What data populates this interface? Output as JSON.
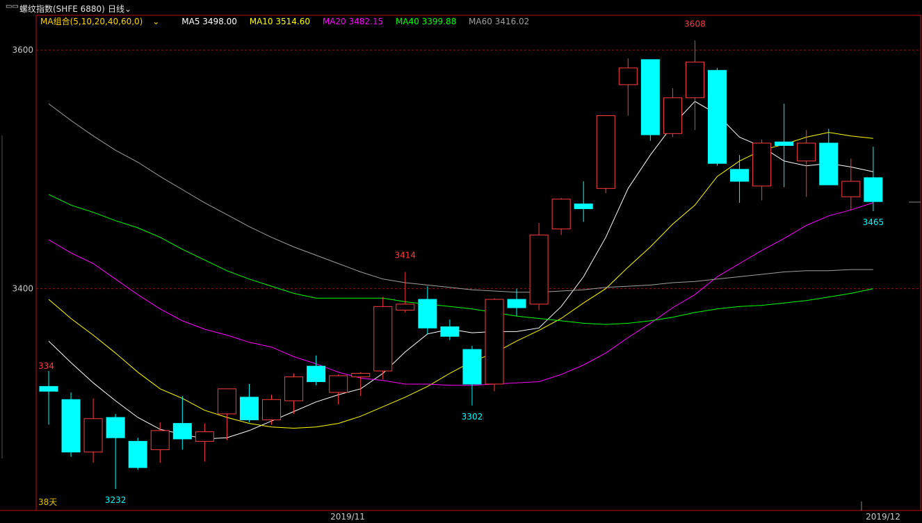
{
  "header": {
    "instrument": "螺纹指数(SHFE 6880)",
    "period": "日线",
    "period_icon": "chevron-down-icon",
    "window_icon": "window-icon"
  },
  "legend": {
    "group_label": "MA组合(5,10,20,40,60,0)",
    "ma5": "MA5 3498.00",
    "ma10": "MA10 3514.60",
    "ma20": "MA20 3482.15",
    "ma40": "MA40 3399.88",
    "ma60": "MA60 3416.02"
  },
  "colors": {
    "up": "#ff3c3c",
    "down": "#00ffff",
    "ma5": "#ffffff",
    "ma10": "#ffff00",
    "ma20": "#ff00ff",
    "ma40": "#00ff00",
    "ma60": "#a0a0a0",
    "border": "#c01010"
  },
  "chart_data": {
    "type": "candlestick",
    "ytick_labels": [
      "3600",
      "3400"
    ],
    "yticks": [
      3600,
      3400
    ],
    "ylim": [
      3214,
      3628
    ],
    "xtick_labels": [
      "2019/11",
      "2019/12"
    ],
    "corner_label_top": "334",
    "corner_label_bottom": "38天",
    "annotations": [
      {
        "label": "3608",
        "index": 29,
        "value": 3608,
        "kind": "high"
      },
      {
        "label": "3414",
        "index": 16,
        "value": 3414,
        "kind": "high"
      },
      {
        "label": "3302",
        "index": 19,
        "value": 3302,
        "kind": "low"
      },
      {
        "label": "3232",
        "index": 3,
        "value": 3232,
        "kind": "low"
      },
      {
        "label": "3465",
        "index": 37,
        "value": 3465,
        "kind": "low"
      }
    ],
    "candles": [
      {
        "o": 3318,
        "h": 3331,
        "l": 3286,
        "c": 3314
      },
      {
        "o": 3307,
        "h": 3313,
        "l": 3259,
        "c": 3263
      },
      {
        "o": 3263,
        "h": 3308,
        "l": 3254,
        "c": 3291
      },
      {
        "o": 3292,
        "h": 3295,
        "l": 3232,
        "c": 3275
      },
      {
        "o": 3272,
        "h": 3275,
        "l": 3248,
        "c": 3250
      },
      {
        "o": 3265,
        "h": 3288,
        "l": 3254,
        "c": 3281
      },
      {
        "o": 3287,
        "h": 3310,
        "l": 3265,
        "c": 3274
      },
      {
        "o": 3272,
        "h": 3287,
        "l": 3255,
        "c": 3280
      },
      {
        "o": 3295,
        "h": 3303,
        "l": 3273,
        "c": 3316
      },
      {
        "o": 3309,
        "h": 3320,
        "l": 3288,
        "c": 3290
      },
      {
        "o": 3290,
        "h": 3311,
        "l": 3286,
        "c": 3307
      },
      {
        "o": 3306,
        "h": 3329,
        "l": 3295,
        "c": 3326
      },
      {
        "o": 3335,
        "h": 3344,
        "l": 3319,
        "c": 3322
      },
      {
        "o": 3313,
        "h": 3328,
        "l": 3303,
        "c": 3327
      },
      {
        "o": 3326,
        "h": 3330,
        "l": 3310,
        "c": 3329
      },
      {
        "o": 3331,
        "h": 3393,
        "l": 3324,
        "c": 3385
      },
      {
        "o": 3382,
        "h": 3414,
        "l": 3380,
        "c": 3387
      },
      {
        "o": 3391,
        "h": 3402,
        "l": 3362,
        "c": 3367
      },
      {
        "o": 3368,
        "h": 3374,
        "l": 3357,
        "c": 3360
      },
      {
        "o": 3349,
        "h": 3352,
        "l": 3302,
        "c": 3320
      },
      {
        "o": 3320,
        "h": 3392,
        "l": 3314,
        "c": 3391
      },
      {
        "o": 3391,
        "h": 3400,
        "l": 3377,
        "c": 3384
      },
      {
        "o": 3387,
        "h": 3455,
        "l": 3382,
        "c": 3445
      },
      {
        "o": 3450,
        "h": 3476,
        "l": 3445,
        "c": 3475
      },
      {
        "o": 3471,
        "h": 3490,
        "l": 3456,
        "c": 3467
      },
      {
        "o": 3484,
        "h": 3539,
        "l": 3480,
        "c": 3545
      },
      {
        "o": 3571,
        "h": 3593,
        "l": 3545,
        "c": 3585
      },
      {
        "o": 3592,
        "h": 3591,
        "l": 3524,
        "c": 3529
      },
      {
        "o": 3530,
        "h": 3568,
        "l": 3527,
        "c": 3560
      },
      {
        "o": 3560,
        "h": 3608,
        "l": 3533,
        "c": 3590
      },
      {
        "o": 3583,
        "h": 3585,
        "l": 3503,
        "c": 3505
      },
      {
        "o": 3500,
        "h": 3512,
        "l": 3472,
        "c": 3490
      },
      {
        "o": 3486,
        "h": 3525,
        "l": 3474,
        "c": 3522
      },
      {
        "o": 3523,
        "h": 3555,
        "l": 3485,
        "c": 3520
      },
      {
        "o": 3507,
        "h": 3533,
        "l": 3477,
        "c": 3522
      },
      {
        "o": 3522,
        "h": 3534,
        "l": 3487,
        "c": 3487
      },
      {
        "o": 3477,
        "h": 3509,
        "l": 3466,
        "c": 3490
      },
      {
        "o": 3493,
        "h": 3519,
        "l": 3465,
        "c": 3473
      }
    ],
    "series": [
      {
        "name": "MA5",
        "values": [
          3356,
          3338,
          3321,
          3306,
          3292,
          3282,
          3278,
          3274,
          3275,
          3281,
          3289,
          3297,
          3305,
          3311,
          3316,
          3329,
          3347,
          3362,
          3366,
          3363,
          3364,
          3364,
          3367,
          3385,
          3410,
          3443,
          3484,
          3512,
          3537,
          3557,
          3546,
          3527,
          3519,
          3507,
          3503,
          3505,
          3502,
          3498
        ]
      },
      {
        "name": "MA10",
        "values": [
          3391,
          3375,
          3361,
          3346,
          3330,
          3316,
          3308,
          3298,
          3292,
          3287,
          3284,
          3283,
          3284,
          3287,
          3293,
          3301,
          3309,
          3318,
          3329,
          3339,
          3346,
          3356,
          3365,
          3375,
          3388,
          3400,
          3418,
          3435,
          3454,
          3470,
          3494,
          3507,
          3516,
          3521,
          3527,
          3531,
          3528,
          3526
        ]
      },
      {
        "name": "MA20",
        "values": [
          3441,
          3430,
          3421,
          3408,
          3395,
          3383,
          3373,
          3366,
          3361,
          3355,
          3351,
          3343,
          3337,
          3330,
          3325,
          3323,
          3320,
          3320,
          3319,
          3319,
          3320,
          3321,
          3322,
          3328,
          3336,
          3346,
          3359,
          3371,
          3384,
          3395,
          3410,
          3421,
          3432,
          3442,
          3453,
          3461,
          3466,
          3472
        ]
      },
      {
        "name": "MA40",
        "values": [
          3479,
          3470,
          3464,
          3457,
          3451,
          3443,
          3433,
          3424,
          3415,
          3408,
          3402,
          3396,
          3392,
          3392,
          3392,
          3392,
          3389,
          3387,
          3385,
          3383,
          3380,
          3377,
          3375,
          3373,
          3371,
          3370,
          3371,
          3373,
          3376,
          3380,
          3383,
          3385,
          3386,
          3388,
          3390,
          3393,
          3396,
          3400
        ]
      },
      {
        "name": "MA60",
        "values": [
          3555,
          3541,
          3528,
          3516,
          3506,
          3494,
          3483,
          3472,
          3462,
          3452,
          3443,
          3435,
          3428,
          3421,
          3414,
          3408,
          3405,
          3403,
          3401,
          3399,
          3398,
          3397,
          3397,
          3398,
          3399,
          3401,
          3402,
          3403,
          3405,
          3406,
          3408,
          3410,
          3412,
          3414,
          3415,
          3415,
          3416,
          3416
        ]
      }
    ]
  }
}
